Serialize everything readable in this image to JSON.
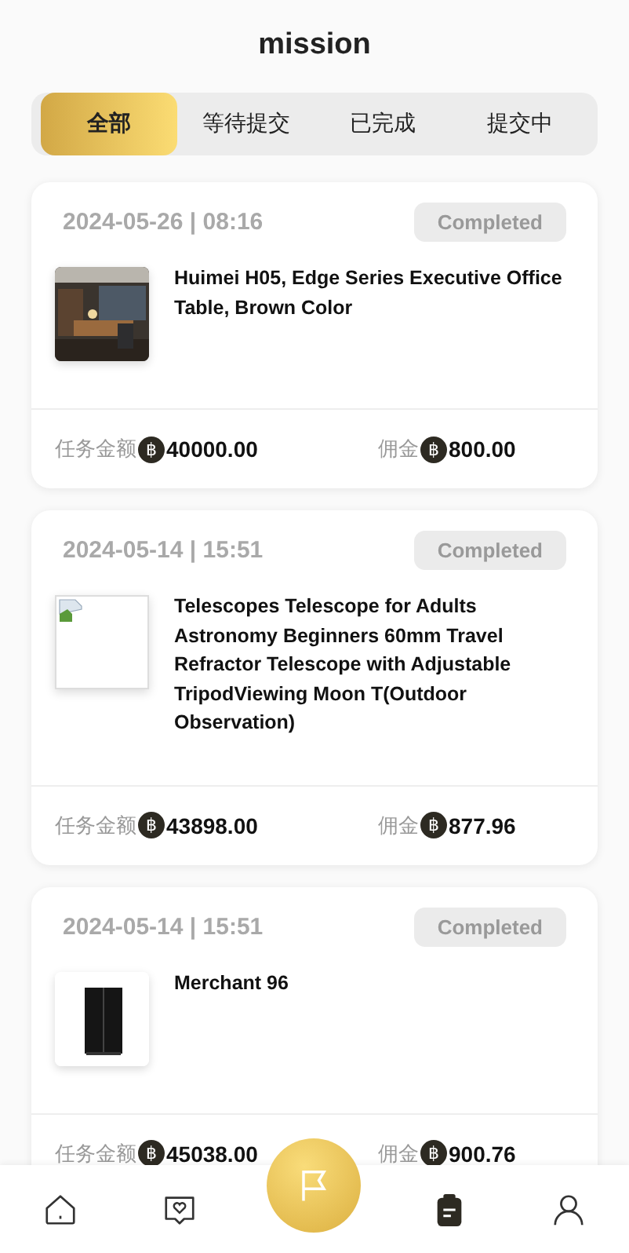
{
  "header": {
    "title": "mission"
  },
  "tabs": [
    {
      "label": "全部",
      "selected": true
    },
    {
      "label": "等待提交",
      "selected": false
    },
    {
      "label": "已完成",
      "selected": false
    },
    {
      "label": "提交中",
      "selected": false
    }
  ],
  "orders": [
    {
      "time": "2024-05-26 | 08:16",
      "status": "Completed",
      "kind": "office",
      "title": "Huimei H05, Edge Series Executive Office Table, Brown Color",
      "amount_label": "任务金额",
      "amount_symbol": "฿",
      "amount": "40000.00",
      "commission_label": "佣金",
      "commission_symbol": "฿",
      "commission": "800.00"
    },
    {
      "time": "2024-05-14 | 15:51",
      "status": "Completed",
      "kind": "broken",
      "title": "Telescopes Telescope for Adults Astronomy Beginners 60mm Travel Refractor Telescope with Adjustable TripodViewing Moon T(Outdoor Observation)",
      "amount_label": "任务金额",
      "amount_symbol": "฿",
      "amount": "43898.00",
      "commission_label": "佣金",
      "commission_symbol": "฿",
      "commission": "877.96"
    },
    {
      "time": "2024-05-14 | 15:51",
      "status": "Completed",
      "kind": "fridge",
      "title": "Merchant 96",
      "amount_label": "任务金额",
      "amount_symbol": "฿",
      "amount": "45038.00",
      "commission_label": "佣金",
      "commission_symbol": "฿",
      "commission": "900.76"
    }
  ],
  "nav": [
    {
      "kind": "home",
      "selected": false
    },
    {
      "kind": "messages",
      "selected": false
    },
    {
      "kind": "center",
      "selected": false
    },
    {
      "kind": "tasks",
      "selected": true
    },
    {
      "kind": "profile",
      "selected": false
    }
  ]
}
